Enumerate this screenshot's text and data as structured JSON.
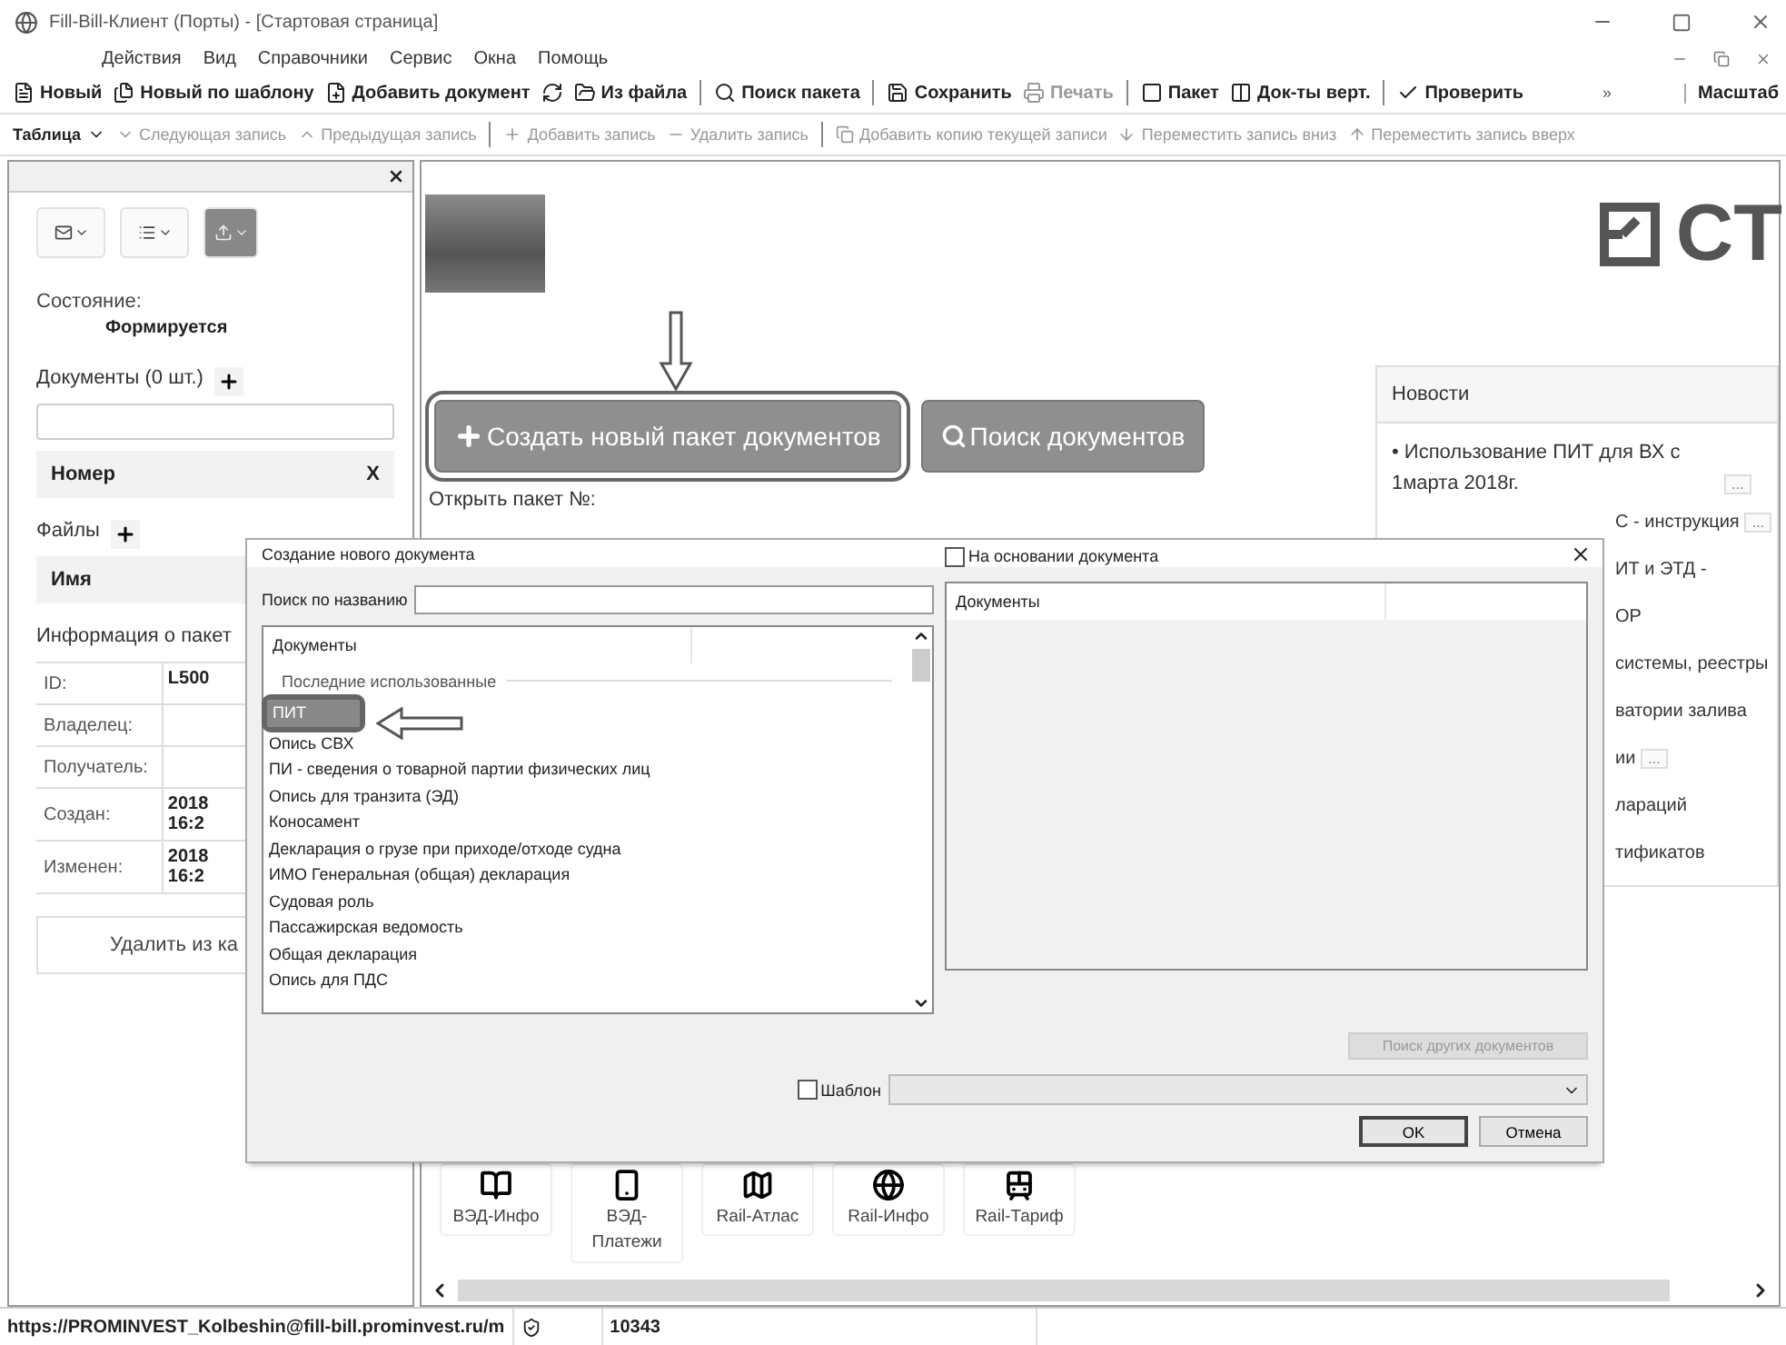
{
  "window": {
    "title": "Fill-Bill-Клиент (Порты) - [Стартовая страница]"
  },
  "menu": [
    "Действия",
    "Вид",
    "Справочники",
    "Сервис",
    "Окна",
    "Помощь"
  ],
  "toolbar": {
    "groups": [
      [
        {
          "kind": "button",
          "label": "Новый",
          "disabled": false
        },
        {
          "kind": "button",
          "label": "Новый по шаблону",
          "disabled": false
        },
        {
          "kind": "button",
          "label": "Добавить документ",
          "disabled": false
        },
        {
          "kind": "icon",
          "disabled": false
        },
        {
          "kind": "button",
          "label": "Из файла",
          "disabled": false
        }
      ],
      [
        {
          "kind": "button",
          "label": "Поиск пакета",
          "disabled": false
        }
      ],
      [
        {
          "kind": "button",
          "label": "Сохранить",
          "disabled": false
        },
        {
          "kind": "button",
          "label": "Печать",
          "disabled": true
        }
      ],
      [
        {
          "kind": "button",
          "label": "Пакет",
          "disabled": false
        },
        {
          "kind": "button",
          "label": "Док-ты верт.",
          "disabled": false
        }
      ],
      [
        {
          "kind": "button",
          "label": "Проверить",
          "disabled": false
        }
      ]
    ],
    "overflow": "»",
    "zoom_label": "Масштаб"
  },
  "table_toolbar": {
    "label": "Таблица",
    "groups": [
      [
        {
          "label": "Следующая запись",
          "disabled": true
        },
        {
          "label": "Предыдущая запись",
          "disabled": true
        }
      ],
      [
        {
          "label": "Добавить запись",
          "disabled": true
        },
        {
          "label": "Удалить запись",
          "disabled": true
        }
      ],
      [
        {
          "label": "Добавить копию текущей записи",
          "disabled": true
        },
        {
          "label": "Переместить запись вниз",
          "disabled": true
        },
        {
          "label": "Переместить запись вверх",
          "disabled": true
        }
      ]
    ]
  },
  "left_panel": {
    "tool_buttons": [
      {
        "selected": false
      },
      {
        "selected": false
      },
      {
        "selected": true
      }
    ],
    "status_label": "Состояние:",
    "status_value": "Формируется",
    "documents": {
      "title": "Документы (0 шт.)",
      "columns": [
        "Номер",
        "X"
      ]
    },
    "files": {
      "title": "Файлы",
      "columns": [
        "Имя"
      ]
    },
    "info": {
      "title": "Информация о пакет",
      "rows": [
        {
          "label": "ID:",
          "value": "L500"
        },
        {
          "label": "Владелец:"
        },
        {
          "label": "Получатель:"
        },
        {
          "label": "Создан:",
          "value": "2018 16:2"
        },
        {
          "label": "Изменен:",
          "value": "2018 16:2"
        }
      ]
    },
    "delete_button": "Удалить из ка"
  },
  "main": {
    "logo": "CT",
    "create_button": "Создать новый пакет документов",
    "search_button": "Поиск документов",
    "open_package_label": "Открыть пакет №:",
    "news": {
      "title": "Новости",
      "items": [
        {
          "text": "• Использование ПИТ для ВХ с 1марта 2018г.",
          "more": "..."
        }
      ],
      "fragments": [
        {
          "text": "С - инструкция",
          "more": "..."
        },
        {
          "text": "ИТ и ЭТД -"
        },
        {
          "text": "ОР"
        },
        {
          "text": "системы, реестры"
        },
        {
          "text": "ватории залива"
        },
        {
          "text": "ии",
          "more": "..."
        },
        {
          "text": "лараций"
        },
        {
          "text": "тификатов"
        }
      ]
    },
    "apps": [
      "ВЭД-Инфо",
      "ВЭД-Платежи",
      "Rail-Атлас",
      "Rail-Инфо",
      "Rail-Тариф"
    ]
  },
  "dialog": {
    "title": "Создание нового документа",
    "search_label": "Поиск по названию",
    "based_on": {
      "label": "На основании документа",
      "checked": false
    },
    "left_list": {
      "header": "Документы",
      "group": "Последние использованные",
      "items": [
        {
          "label": "ПИТ",
          "selected": true
        },
        {
          "label": "Опись СВХ",
          "selected": false
        },
        {
          "label": "ПИ - сведения о товарной партии физических лиц",
          "selected": false
        },
        {
          "label": "Опись для транзита (ЭД)",
          "selected": false
        },
        {
          "label": "Коносамент",
          "selected": false
        },
        {
          "label": "Декларация о грузе при приходе/отходе судна",
          "selected": false
        },
        {
          "label": "ИМО Генеральная (общая) декларация",
          "selected": false
        },
        {
          "label": "Судовая роль",
          "selected": false
        },
        {
          "label": "Пассажирская ведомость",
          "selected": false
        },
        {
          "label": "Общая декларация",
          "selected": false
        },
        {
          "label": "Опись для ПДС",
          "selected": false
        }
      ]
    },
    "right_list": {
      "header": "Документы"
    },
    "find_other": {
      "label": "Поиск других документов",
      "disabled": true
    },
    "template": {
      "label": "Шаблон",
      "checked": false
    },
    "ok": "OK",
    "cancel": "Отмена"
  },
  "status_bar": {
    "url": "https://PROMINVEST_Kolbeshin@fill-bill.prominvest.ru/m",
    "number": "10343"
  }
}
